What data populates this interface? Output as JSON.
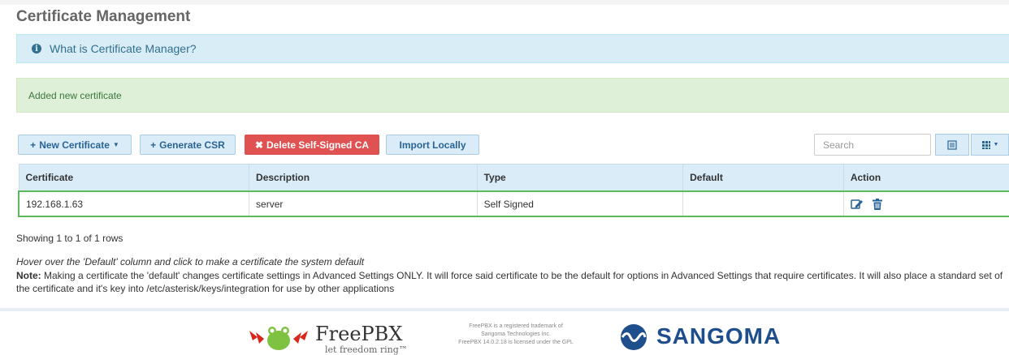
{
  "page": {
    "title": "Certificate Management"
  },
  "info": {
    "text": "What is Certificate Manager?"
  },
  "alert": {
    "text": "Added new certificate"
  },
  "toolbar": {
    "new_certificate": "New Certificate",
    "generate_csr": "Generate CSR",
    "delete_ca": "Delete Self-Signed CA",
    "import_locally": "Import Locally",
    "search_placeholder": "Search"
  },
  "table": {
    "columns": [
      "Certificate",
      "Description",
      "Type",
      "Default",
      "Action"
    ],
    "rows": [
      {
        "certificate": "192.168.1.63",
        "description": "server",
        "type": "Self Signed",
        "default": ""
      }
    ]
  },
  "pagination": {
    "text": "Showing 1 to 1 of 1 rows"
  },
  "notes": {
    "hover": "Hover over the 'Default' column and click to make a certificate the system default",
    "note_label": "Note:",
    "note_text": " Making a certificate the 'default' changes certificate settings in Advanced Settings ONLY. It will force said certificate to be the default for options in Advanced Settings that require certificates. It will also place a standard set of the certificate and it's key into /etc/asterisk/keys/integration for use by other applications"
  },
  "footer": {
    "freepbx_name": "FreePBX",
    "freepbx_tagline": "let freedom ring™",
    "legal_1": "FreePBX is a registered trademark of",
    "legal_2": "Sangoma Technologies Inc.",
    "legal_3": "FreePBX 14.0.2.18 is licensed under the GPL",
    "sangoma": "SANGOMA"
  },
  "colors": {
    "accent": "#d9ecf8",
    "danger": "#e05252",
    "success_bg": "#dff0d8",
    "info_bg": "#d9edf7",
    "selection": "#5cb85c"
  }
}
